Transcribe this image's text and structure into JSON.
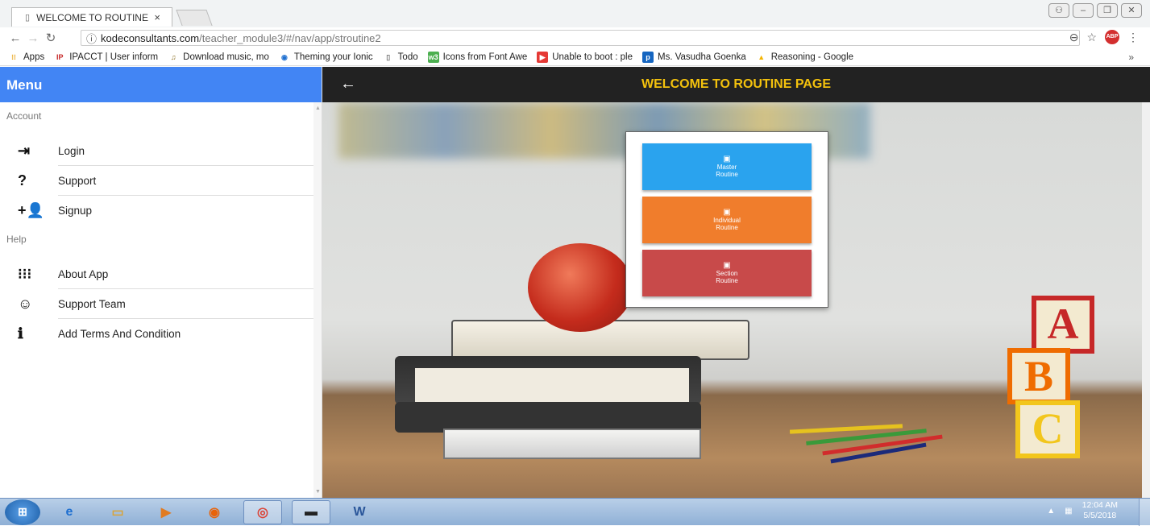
{
  "browser": {
    "tab_title": "WELCOME TO ROUTINE",
    "tab_close": "×",
    "url_host": "kodeconsultants.com",
    "url_path": "/teacher_module3/#/nav/app/stroutine2",
    "info_icon": "ⓘ",
    "bookmarks": [
      {
        "label": "Apps",
        "icon": "apps-grid-icon"
      },
      {
        "label": "IPACCT | User inform",
        "icon": "ip-icon"
      },
      {
        "label": "Download music, mo",
        "icon": "music-icon"
      },
      {
        "label": "Theming your Ionic",
        "icon": "ionic-icon"
      },
      {
        "label": "Todo",
        "icon": "page-icon"
      },
      {
        "label": "Icons from Font Awe",
        "icon": "w3-icon"
      },
      {
        "label": "Unable to boot : ple",
        "icon": "youtube-icon"
      },
      {
        "label": "Ms. Vasudha Goenka",
        "icon": "p-icon"
      },
      {
        "label": "Reasoning - Google",
        "icon": "drive-icon"
      }
    ],
    "bookmarks_more": "»"
  },
  "sidebar": {
    "title": "Menu",
    "sections": [
      {
        "label": "Account",
        "items": [
          {
            "label": "Login",
            "icon": "login-icon",
            "glyph": "⇥"
          },
          {
            "label": "Support",
            "icon": "question-icon",
            "glyph": "?"
          },
          {
            "label": "Signup",
            "icon": "person-add-icon",
            "glyph": "+👤"
          }
        ]
      },
      {
        "label": "Help",
        "items": [
          {
            "label": "About App",
            "icon": "grid-icon",
            "glyph": "⁝⁝⁝"
          },
          {
            "label": "Support Team",
            "icon": "smiley-icon",
            "glyph": "☺"
          },
          {
            "label": "Add Terms And Condition",
            "icon": "info-icon",
            "glyph": "ℹ"
          }
        ]
      }
    ]
  },
  "header": {
    "title": "WELCOME TO ROUTINE PAGE",
    "back_glyph": "←"
  },
  "routine": {
    "buttons": [
      {
        "line1": "Master",
        "line2": "Routine",
        "color": "#2aa3ee"
      },
      {
        "line1": "Individual",
        "line2": "Routine",
        "color": "#f07d2c"
      },
      {
        "line1": "Section",
        "line2": "Routine",
        "color": "#c84a4a"
      }
    ]
  },
  "scene": {
    "blocks": [
      "A",
      "B",
      "C"
    ]
  },
  "taskbar": {
    "time": "12:04 AM",
    "date": "5/5/2018"
  },
  "colors": {
    "menu_header": "#4285f4",
    "title_text": "#f4c20d",
    "topbar": "#222222"
  }
}
